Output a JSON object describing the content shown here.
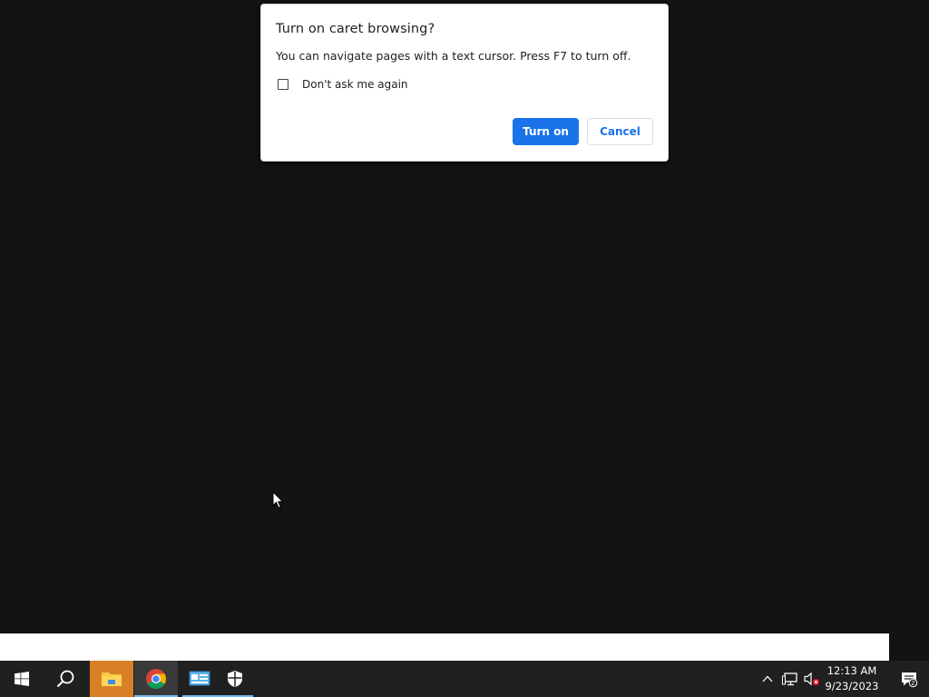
{
  "dialog": {
    "title": "Turn on caret browsing?",
    "body": "You can navigate pages with a text cursor. Press F7 to turn off.",
    "checkbox_label": "Don't ask me again",
    "checkbox_checked": false,
    "primary_button": "Turn on",
    "secondary_button": "Cancel"
  },
  "taskbar": {
    "apps": [
      {
        "name": "Start",
        "icon": "windows-logo-icon"
      },
      {
        "name": "Search",
        "icon": "search-icon"
      },
      {
        "name": "File Explorer",
        "icon": "folder-icon",
        "active": true
      },
      {
        "name": "Google Chrome",
        "icon": "chrome-icon",
        "running": true
      },
      {
        "name": "Control Panel",
        "icon": "control-panel-icon",
        "running": true
      },
      {
        "name": "Windows Security",
        "icon": "shield-icon"
      }
    ],
    "clock": {
      "time": "12:13 AM",
      "date": "9/23/2023"
    },
    "notification_count": "2"
  },
  "colors": {
    "desktop": "#131313",
    "taskbar": "#202020",
    "accent": "#1a73e8",
    "explorer_highlight": "#d98026",
    "running_underline": "#76b9ed"
  }
}
